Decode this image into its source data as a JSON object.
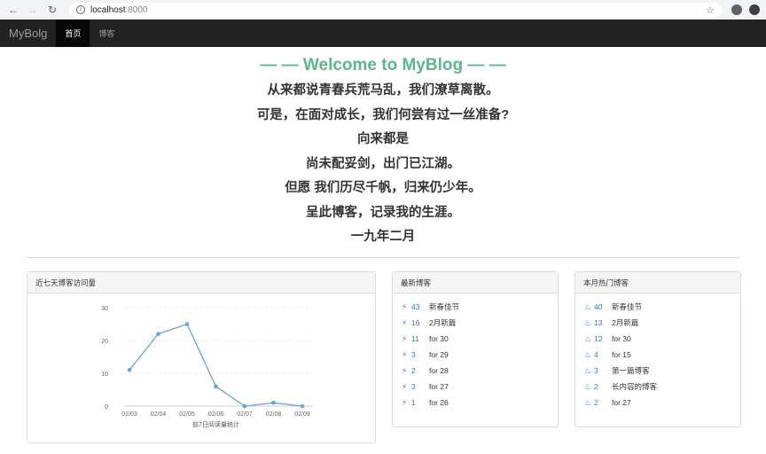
{
  "browser": {
    "url_host": "localhost",
    "url_port": ":8000"
  },
  "navbar": {
    "brand": "MyBolg",
    "items": [
      {
        "label": "首页",
        "active": true
      },
      {
        "label": "博客",
        "active": false
      }
    ]
  },
  "hero": {
    "title": "— — Welcome to MyBlog — —",
    "lines": [
      "从来都说青春兵荒马乱，我们潦草离散。",
      "可是，在面对成长，我们何尝有过一丝准备?",
      "向来都是",
      "尚未配妥剑，出门已江湖。",
      "但愿 我们历尽千帆，归来仍少年。",
      "呈此博客，记录我的生涯。",
      "一九年二月"
    ]
  },
  "visits_panel": {
    "heading": "近七天博客访问量"
  },
  "chart_data": {
    "type": "line",
    "categories": [
      "02/03",
      "02/04",
      "02/05",
      "02/06",
      "02/07",
      "02/08",
      "02/09"
    ],
    "series": [
      {
        "values": [
          11,
          22,
          25,
          6,
          0,
          1,
          0
        ]
      }
    ],
    "xlabel": "前7日阅读量统计",
    "ylabel": "",
    "ylim": [
      0,
      30
    ],
    "yticks": [
      0,
      10,
      20,
      30
    ],
    "grid": true,
    "color": "#6aa3d9"
  },
  "latest_panel": {
    "heading": "最新博客",
    "items": [
      {
        "count": "43",
        "title": "新春佳节"
      },
      {
        "count": "16",
        "title": "2月新篇"
      },
      {
        "count": "11",
        "title": "for 30"
      },
      {
        "count": "3",
        "title": "for 29"
      },
      {
        "count": "2",
        "title": "for 28"
      },
      {
        "count": "3",
        "title": "for 27"
      },
      {
        "count": "1",
        "title": "for 26"
      }
    ]
  },
  "hot_panel": {
    "heading": "本月热门博客",
    "items": [
      {
        "count": "40",
        "title": "新春佳节"
      },
      {
        "count": "13",
        "title": "2月新篇"
      },
      {
        "count": "12",
        "title": "for 30"
      },
      {
        "count": "4",
        "title": "for 15"
      },
      {
        "count": "3",
        "title": "第一篇博客"
      },
      {
        "count": "2",
        "title": "长内容的博客"
      },
      {
        "count": "2",
        "title": "for 27"
      }
    ]
  },
  "icons": {
    "latest": "bolt-icon",
    "hot": "fire-icon"
  },
  "colors": {
    "accent_green": "#5cb88a",
    "link_blue": "#337ab7",
    "navbar_bg": "#222222"
  }
}
